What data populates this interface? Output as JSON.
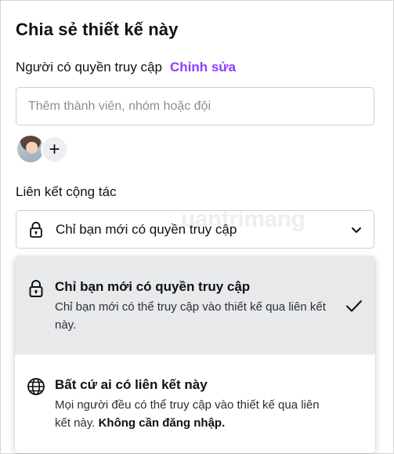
{
  "dialog": {
    "title": "Chia sẻ thiết kế này",
    "access_label": "Người có quyền truy cập",
    "edit_link": "Chỉnh sửa",
    "member_input_placeholder": "Thêm thành viên, nhóm hoặc đội",
    "add_member_symbol": "+",
    "collab_label": "Liên kết cộng tác",
    "link_select_value": "Chỉ bạn mới có quyền truy cập"
  },
  "watermark": "uantrimang",
  "dropdown": {
    "options": [
      {
        "title": "Chỉ bạn mới có quyền truy cập",
        "description": "Chỉ bạn mới có thể truy cập vào thiết kế qua liên kết này.",
        "icon": "lock-icon",
        "selected": true
      },
      {
        "title": "Bất cứ ai có liên kết này",
        "description": "Mọi người đều có thể truy cập vào thiết kế qua liên kết này.",
        "description_bold": "Không cần đăng nhập.",
        "icon": "globe-icon",
        "selected": false
      }
    ]
  },
  "colors": {
    "accent": "#8b3dff",
    "selected_bg": "#e8e9eb",
    "text": "#0d1216"
  }
}
